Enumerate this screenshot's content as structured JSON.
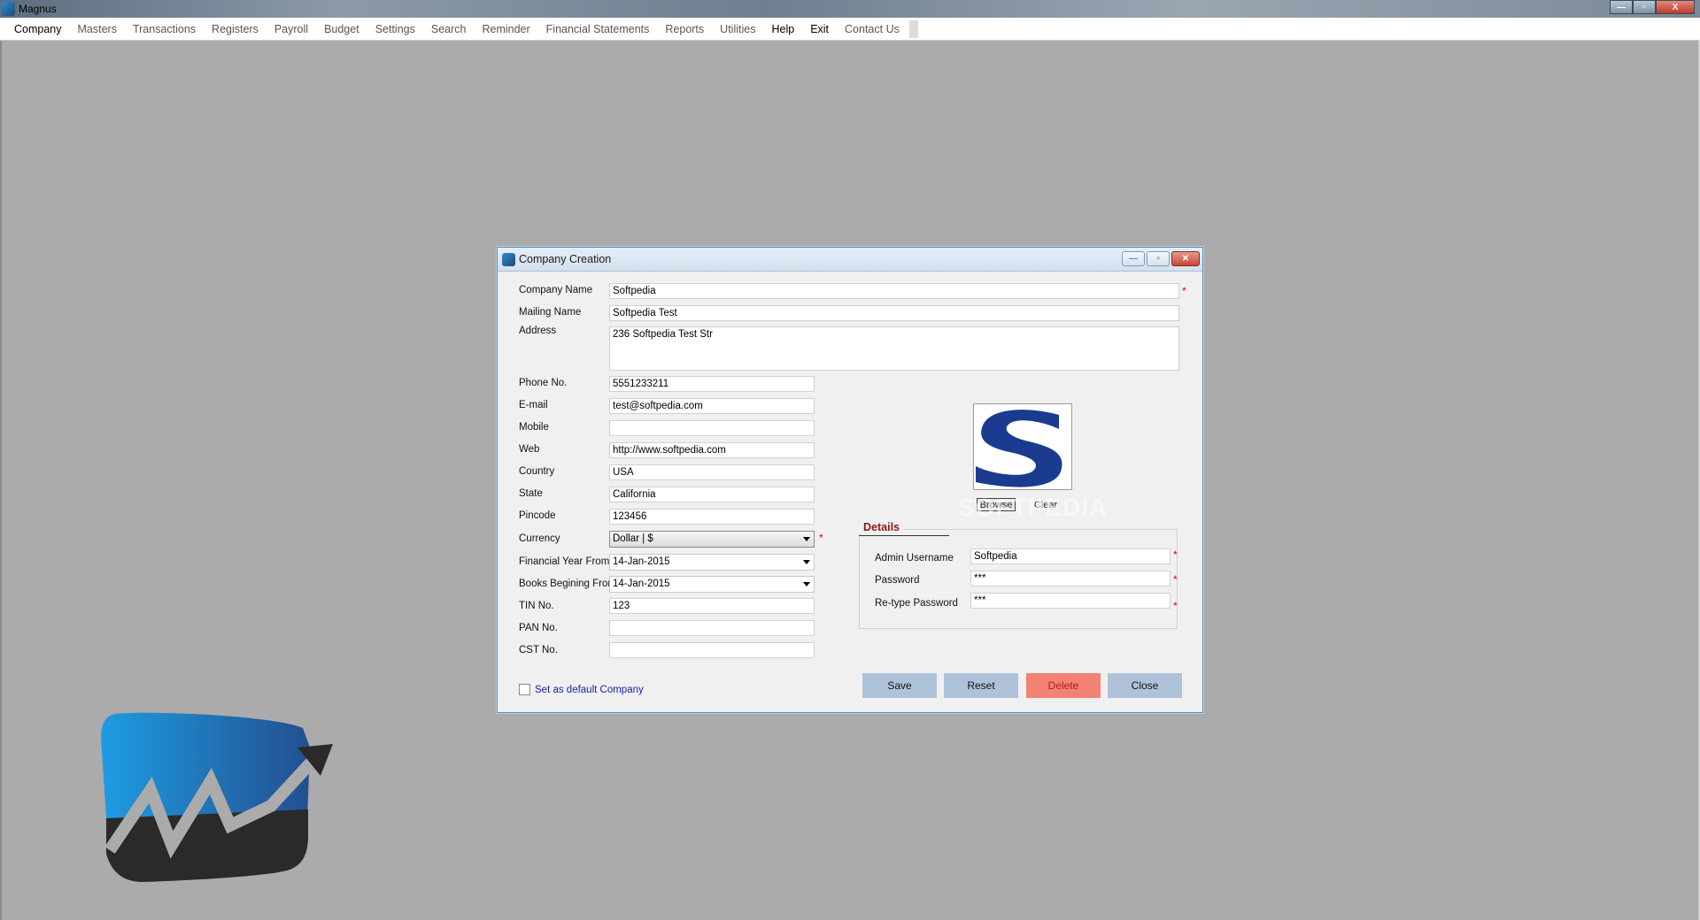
{
  "app": {
    "title": "Magnus",
    "controls": {
      "minimize": "—",
      "maximize": "▫",
      "close": "X"
    }
  },
  "menu": [
    {
      "label": "Company",
      "style": "active"
    },
    {
      "label": "Masters",
      "style": "normal"
    },
    {
      "label": "Transactions",
      "style": "normal"
    },
    {
      "label": "Registers",
      "style": "normal"
    },
    {
      "label": "Payroll",
      "style": "normal"
    },
    {
      "label": "Budget",
      "style": "normal"
    },
    {
      "label": "Settings",
      "style": "normal"
    },
    {
      "label": "Search",
      "style": "normal"
    },
    {
      "label": "Reminder",
      "style": "normal"
    },
    {
      "label": "Financial Statements",
      "style": "normal"
    },
    {
      "label": "Reports",
      "style": "normal"
    },
    {
      "label": "Utilities",
      "style": "normal"
    },
    {
      "label": "Help",
      "style": "dark"
    },
    {
      "label": "Exit",
      "style": "dark"
    },
    {
      "label": "Contact Us",
      "style": "normal"
    }
  ],
  "dialog": {
    "title": "Company Creation",
    "controls": {
      "minimize": "—",
      "maximize": "▫",
      "close": "✕"
    },
    "labels": {
      "company_name": "Company Name",
      "mailing_name": "Mailing Name",
      "address": "Address",
      "phone": "Phone No.",
      "email": "E-mail",
      "mobile": "Mobile",
      "web": "Web",
      "country": "Country",
      "state": "State",
      "pincode": "Pincode",
      "currency": "Currency",
      "fy_from": "Financial Year From",
      "books_from": "Books Begining From",
      "tin": "TIN No.",
      "pan": "PAN No.",
      "cst": "CST No."
    },
    "values": {
      "company_name": "Softpedia",
      "mailing_name": "Softpedia Test",
      "address": "236 Softpedia Test Str",
      "phone": "5551233211",
      "email": "test@softpedia.com",
      "mobile": "",
      "web": "http://www.softpedia.com",
      "country": "USA",
      "state": "California",
      "pincode": "123456",
      "currency": "Dollar | $",
      "fy_from": "14-Jan-2015",
      "books_from": "14-Jan-2015",
      "tin": "123",
      "pan": "",
      "cst": ""
    },
    "required_mark": "*",
    "logo": {
      "browse_label": "Browse",
      "clear_label": "Clear",
      "watermark": "SOFTPEDIA",
      "brand_color": "#1a3b8f"
    },
    "details": {
      "title": "Details",
      "admin_username_label": "Admin Username",
      "admin_username_value": "Softpedia",
      "password_label": "Password",
      "password_value": "***",
      "retype_label": "Re-type Password",
      "retype_value": "***"
    },
    "default_company_label": "Set as default Company",
    "default_company_checked": false,
    "buttons": {
      "save": "Save",
      "reset": "Reset",
      "delete": "Delete",
      "close": "Close"
    }
  }
}
